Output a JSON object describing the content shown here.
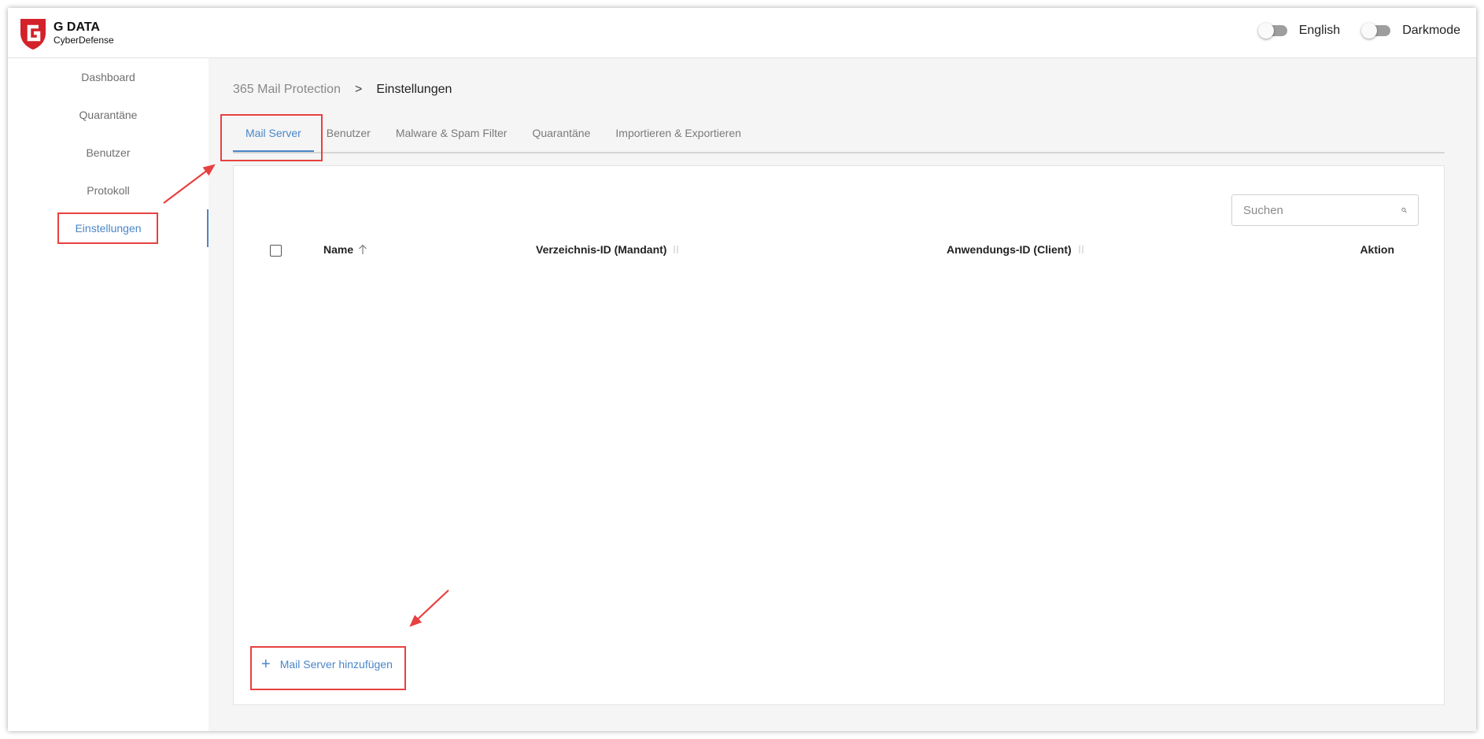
{
  "brand": {
    "name": "G DATA",
    "subtitle": "CyberDefense"
  },
  "toggles": [
    {
      "label": "English",
      "on": false
    },
    {
      "label": "Darkmode",
      "on": false
    }
  ],
  "sidebar": {
    "items": [
      {
        "label": "Dashboard",
        "active": false
      },
      {
        "label": "Quarantäne",
        "active": false
      },
      {
        "label": "Benutzer",
        "active": false
      },
      {
        "label": "Protokoll",
        "active": false
      },
      {
        "label": "Einstellungen",
        "active": true
      }
    ]
  },
  "breadcrumb": {
    "parent": "365 Mail Protection",
    "separator": ">",
    "current": "Einstellungen"
  },
  "tabs": [
    {
      "label": "Mail Server",
      "active": true
    },
    {
      "label": "Benutzer",
      "active": false
    },
    {
      "label": "Malware & Spam Filter",
      "active": false
    },
    {
      "label": "Quarantäne",
      "active": false
    },
    {
      "label": "Importieren & Exportieren",
      "active": false
    }
  ],
  "search": {
    "placeholder": "Suchen"
  },
  "table": {
    "columns": [
      {
        "label": "Name",
        "sort": "ascending"
      },
      {
        "label": "Verzeichnis-ID (Mandant)",
        "sort": "none"
      },
      {
        "label": "Anwendungs-ID (Client)",
        "sort": "none"
      },
      {
        "label": "Aktion",
        "sort": "none"
      }
    ],
    "rows": []
  },
  "add_button": {
    "label": "Mail Server hinzufügen"
  },
  "colors": {
    "accent": "#4a86c8",
    "annotation": "#e84040",
    "brand_red": "#d3222a"
  }
}
